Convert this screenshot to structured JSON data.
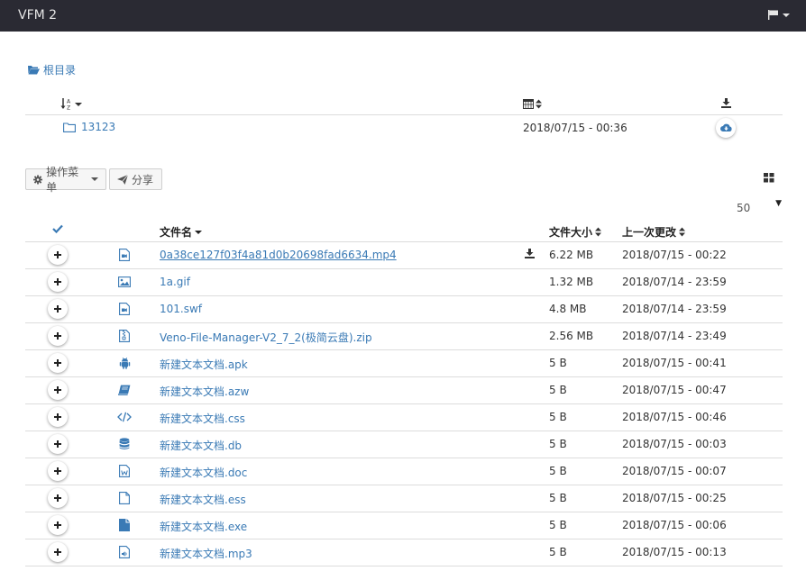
{
  "app": {
    "title": "VFM 2"
  },
  "breadcrumb": {
    "label": "根目录"
  },
  "folders": [
    {
      "name": "13123",
      "date": "2018/07/15 - 00:36"
    }
  ],
  "toolbar": {
    "actions_label": "操作菜单",
    "share_label": "分享",
    "per_page": "50"
  },
  "table": {
    "col_name": "文件名",
    "col_size": "文件大小",
    "col_date": "上一次更改"
  },
  "files": [
    {
      "name": "0a38ce127f03f4a81d0b20698fad6634.mp4",
      "size": "6.22 MB",
      "date": "2018/07/15 - 00:22",
      "icon": "file-video-icon"
    },
    {
      "name": "1a.gif",
      "size": "1.32 MB",
      "date": "2018/07/14 - 23:59",
      "icon": "file-image-icon"
    },
    {
      "name": "101.swf",
      "size": "4.8 MB",
      "date": "2018/07/14 - 23:59",
      "icon": "file-video-icon"
    },
    {
      "name": "Veno-File-Manager-V2_7_2(极简云盘).zip",
      "size": "2.56 MB",
      "date": "2018/07/14 - 23:49",
      "icon": "file-archive-icon"
    },
    {
      "name": "新建文本文档.apk",
      "size": "5 B",
      "date": "2018/07/15 - 00:41",
      "icon": "android-icon"
    },
    {
      "name": "新建文本文档.azw",
      "size": "5 B",
      "date": "2018/07/15 - 00:47",
      "icon": "book-icon"
    },
    {
      "name": "新建文本文档.css",
      "size": "5 B",
      "date": "2018/07/15 - 00:46",
      "icon": "code-icon"
    },
    {
      "name": "新建文本文档.db",
      "size": "5 B",
      "date": "2018/07/15 - 00:03",
      "icon": "database-icon"
    },
    {
      "name": "新建文本文档.doc",
      "size": "5 B",
      "date": "2018/07/15 - 00:07",
      "icon": "file-word-icon"
    },
    {
      "name": "新建文本文档.ess",
      "size": "5 B",
      "date": "2018/07/15 - 00:25",
      "icon": "file-icon"
    },
    {
      "name": "新建文本文档.exe",
      "size": "5 B",
      "date": "2018/07/15 - 00:06",
      "icon": "file-solid-icon"
    },
    {
      "name": "新建文本文档.mp3",
      "size": "5 B",
      "date": "2018/07/15 - 00:13",
      "icon": "file-audio-icon"
    }
  ],
  "colors": {
    "navbar": "#2a2a33",
    "link": "#3a7ab5"
  }
}
